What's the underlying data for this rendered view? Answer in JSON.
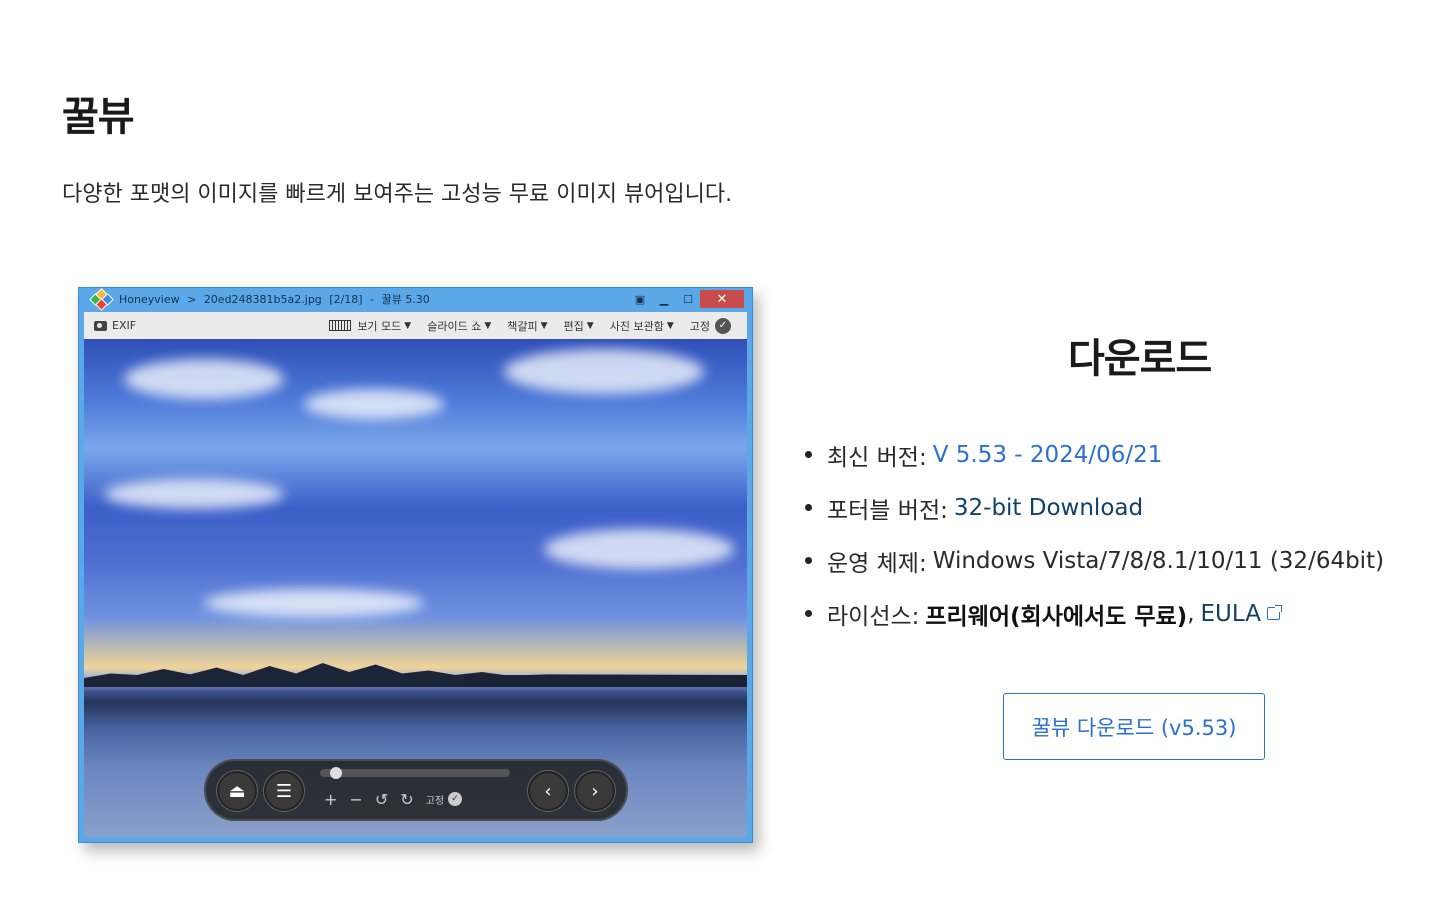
{
  "page": {
    "title": "꿀뷰",
    "description": "다양한 포맷의 이미지를 빠르게 보여주는 고성능 무료 이미지 뷰어입니다."
  },
  "screenshot": {
    "titlebar": {
      "app_name": "Honeyview",
      "separator": ">",
      "file_name": "20ed248381b5a2.jpg",
      "position": "[2/18]",
      "dash": "-",
      "program": "꿀뷰 5.30"
    },
    "toolbar": {
      "exif_label": "EXIF",
      "view_mode": "보기 모드",
      "slideshow": "슬라이드 쇼",
      "bookmark": "책갈피",
      "edit": "편집",
      "photo_storage": "사진 보관함",
      "pin": "고정"
    },
    "overlay": {
      "zoom_in": "+",
      "zoom_out": "−",
      "pin_label": "고정"
    }
  },
  "download": {
    "title": "다운로드",
    "items": [
      {
        "label": "최신 버전:",
        "value": "V 5.53 - 2024/06/21"
      },
      {
        "label": "포터블 버전:",
        "value": "32-bit Download"
      },
      {
        "label": "운영 체제:",
        "value": "Windows Vista/7/8/8.1/10/11 (32/64bit)"
      },
      {
        "label": "라이선스:",
        "value": "프리웨어(회사에서도 무료)",
        "comma": ",",
        "link": "EULA"
      }
    ],
    "button_label": "꿀뷰 다운로드 (v5.53)"
  },
  "colors": {
    "link": "#2a6fd6",
    "window_frame": "#5aa8e8",
    "close_button": "#c94c4c"
  }
}
